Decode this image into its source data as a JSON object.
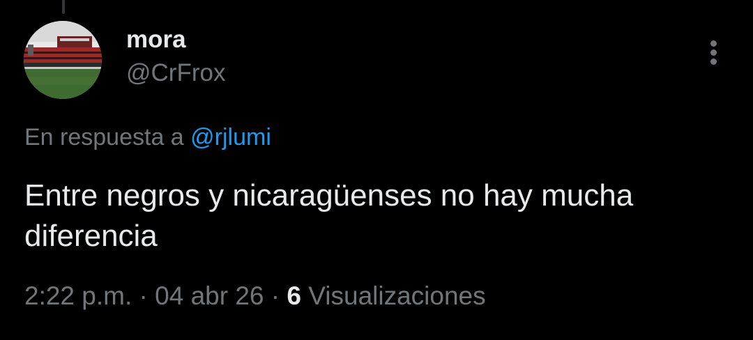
{
  "tweet": {
    "author": {
      "display_name": "mora",
      "handle": "@CrFrox",
      "avatar_icon": "stadium-avatar"
    },
    "reply_to": {
      "prefix": "En respuesta a",
      "handle": "@rjlumi"
    },
    "text": "Entre negros y nicaragüenses no hay mucha diferencia",
    "meta": {
      "time": "2:22 p.m.",
      "separator": "·",
      "date": "04 abr 26",
      "views_count": "6",
      "views_label": "Visualizaciones"
    },
    "more_icon": "more-vertical-icon"
  },
  "colors": {
    "background": "#000000",
    "primary_text": "#e7e9ea",
    "secondary_text": "#71767b",
    "accent": "#1d9bf0"
  }
}
